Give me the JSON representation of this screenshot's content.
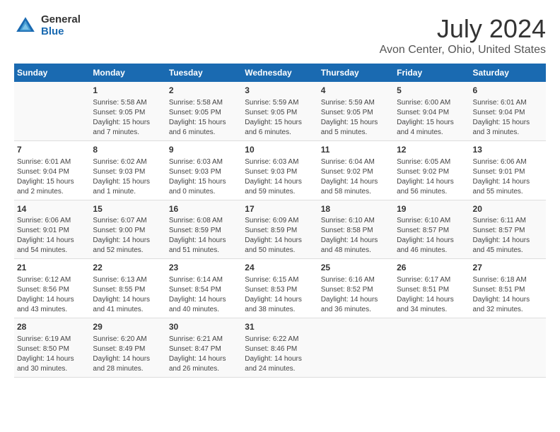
{
  "header": {
    "logo": {
      "general": "General",
      "blue": "Blue"
    },
    "title": "July 2024",
    "subtitle": "Avon Center, Ohio, United States"
  },
  "calendar": {
    "weekdays": [
      "Sunday",
      "Monday",
      "Tuesday",
      "Wednesday",
      "Thursday",
      "Friday",
      "Saturday"
    ],
    "weeks": [
      [
        {
          "day": "",
          "info": ""
        },
        {
          "day": "1",
          "info": "Sunrise: 5:58 AM\nSunset: 9:05 PM\nDaylight: 15 hours\nand 7 minutes."
        },
        {
          "day": "2",
          "info": "Sunrise: 5:58 AM\nSunset: 9:05 PM\nDaylight: 15 hours\nand 6 minutes."
        },
        {
          "day": "3",
          "info": "Sunrise: 5:59 AM\nSunset: 9:05 PM\nDaylight: 15 hours\nand 6 minutes."
        },
        {
          "day": "4",
          "info": "Sunrise: 5:59 AM\nSunset: 9:05 PM\nDaylight: 15 hours\nand 5 minutes."
        },
        {
          "day": "5",
          "info": "Sunrise: 6:00 AM\nSunset: 9:04 PM\nDaylight: 15 hours\nand 4 minutes."
        },
        {
          "day": "6",
          "info": "Sunrise: 6:01 AM\nSunset: 9:04 PM\nDaylight: 15 hours\nand 3 minutes."
        }
      ],
      [
        {
          "day": "7",
          "info": "Sunrise: 6:01 AM\nSunset: 9:04 PM\nDaylight: 15 hours\nand 2 minutes."
        },
        {
          "day": "8",
          "info": "Sunrise: 6:02 AM\nSunset: 9:03 PM\nDaylight: 15 hours\nand 1 minute."
        },
        {
          "day": "9",
          "info": "Sunrise: 6:03 AM\nSunset: 9:03 PM\nDaylight: 15 hours\nand 0 minutes."
        },
        {
          "day": "10",
          "info": "Sunrise: 6:03 AM\nSunset: 9:03 PM\nDaylight: 14 hours\nand 59 minutes."
        },
        {
          "day": "11",
          "info": "Sunrise: 6:04 AM\nSunset: 9:02 PM\nDaylight: 14 hours\nand 58 minutes."
        },
        {
          "day": "12",
          "info": "Sunrise: 6:05 AM\nSunset: 9:02 PM\nDaylight: 14 hours\nand 56 minutes."
        },
        {
          "day": "13",
          "info": "Sunrise: 6:06 AM\nSunset: 9:01 PM\nDaylight: 14 hours\nand 55 minutes."
        }
      ],
      [
        {
          "day": "14",
          "info": "Sunrise: 6:06 AM\nSunset: 9:01 PM\nDaylight: 14 hours\nand 54 minutes."
        },
        {
          "day": "15",
          "info": "Sunrise: 6:07 AM\nSunset: 9:00 PM\nDaylight: 14 hours\nand 52 minutes."
        },
        {
          "day": "16",
          "info": "Sunrise: 6:08 AM\nSunset: 8:59 PM\nDaylight: 14 hours\nand 51 minutes."
        },
        {
          "day": "17",
          "info": "Sunrise: 6:09 AM\nSunset: 8:59 PM\nDaylight: 14 hours\nand 50 minutes."
        },
        {
          "day": "18",
          "info": "Sunrise: 6:10 AM\nSunset: 8:58 PM\nDaylight: 14 hours\nand 48 minutes."
        },
        {
          "day": "19",
          "info": "Sunrise: 6:10 AM\nSunset: 8:57 PM\nDaylight: 14 hours\nand 46 minutes."
        },
        {
          "day": "20",
          "info": "Sunrise: 6:11 AM\nSunset: 8:57 PM\nDaylight: 14 hours\nand 45 minutes."
        }
      ],
      [
        {
          "day": "21",
          "info": "Sunrise: 6:12 AM\nSunset: 8:56 PM\nDaylight: 14 hours\nand 43 minutes."
        },
        {
          "day": "22",
          "info": "Sunrise: 6:13 AM\nSunset: 8:55 PM\nDaylight: 14 hours\nand 41 minutes."
        },
        {
          "day": "23",
          "info": "Sunrise: 6:14 AM\nSunset: 8:54 PM\nDaylight: 14 hours\nand 40 minutes."
        },
        {
          "day": "24",
          "info": "Sunrise: 6:15 AM\nSunset: 8:53 PM\nDaylight: 14 hours\nand 38 minutes."
        },
        {
          "day": "25",
          "info": "Sunrise: 6:16 AM\nSunset: 8:52 PM\nDaylight: 14 hours\nand 36 minutes."
        },
        {
          "day": "26",
          "info": "Sunrise: 6:17 AM\nSunset: 8:51 PM\nDaylight: 14 hours\nand 34 minutes."
        },
        {
          "day": "27",
          "info": "Sunrise: 6:18 AM\nSunset: 8:51 PM\nDaylight: 14 hours\nand 32 minutes."
        }
      ],
      [
        {
          "day": "28",
          "info": "Sunrise: 6:19 AM\nSunset: 8:50 PM\nDaylight: 14 hours\nand 30 minutes."
        },
        {
          "day": "29",
          "info": "Sunrise: 6:20 AM\nSunset: 8:49 PM\nDaylight: 14 hours\nand 28 minutes."
        },
        {
          "day": "30",
          "info": "Sunrise: 6:21 AM\nSunset: 8:47 PM\nDaylight: 14 hours\nand 26 minutes."
        },
        {
          "day": "31",
          "info": "Sunrise: 6:22 AM\nSunset: 8:46 PM\nDaylight: 14 hours\nand 24 minutes."
        },
        {
          "day": "",
          "info": ""
        },
        {
          "day": "",
          "info": ""
        },
        {
          "day": "",
          "info": ""
        }
      ]
    ]
  }
}
